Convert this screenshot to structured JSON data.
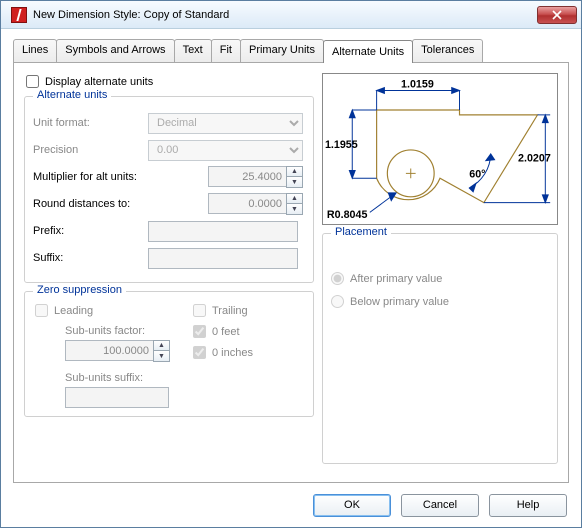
{
  "window": {
    "title": "New Dimension Style: Copy of Standard"
  },
  "tabs": {
    "lines": "Lines",
    "symbols": "Symbols and Arrows",
    "text": "Text",
    "fit": "Fit",
    "primary": "Primary Units",
    "alternate": "Alternate Units",
    "tolerances": "Tolerances"
  },
  "left": {
    "display_alt": "Display alternate units",
    "alt_group": "Alternate units",
    "unit_format_lbl": "Unit format:",
    "unit_format_val": "Decimal",
    "precision_lbl": "Precision",
    "precision_val": "0.00",
    "multiplier_lbl": "Multiplier for alt units:",
    "multiplier_val": "25.4000",
    "round_lbl": "Round distances to:",
    "round_val": "0.0000",
    "prefix_lbl": "Prefix:",
    "prefix_val": "",
    "suffix_lbl": "Suffix:",
    "suffix_val": "",
    "zs_group": "Zero suppression",
    "leading": "Leading",
    "trailing": "Trailing",
    "feet0": "0 feet",
    "inches0": "0 inches",
    "subfactor_lbl": "Sub-units factor:",
    "subfactor_val": "100.0000",
    "subsuffix_lbl": "Sub-units suffix:",
    "subsuffix_val": ""
  },
  "preview": {
    "d1": "1.0159",
    "d2": "1.1955",
    "d3": "2.0207",
    "ang": "60°",
    "rad": "R0.8045"
  },
  "placement": {
    "legend": "Placement",
    "after": "After primary value",
    "below": "Below primary value"
  },
  "footer": {
    "ok": "OK",
    "cancel": "Cancel",
    "help": "Help"
  }
}
